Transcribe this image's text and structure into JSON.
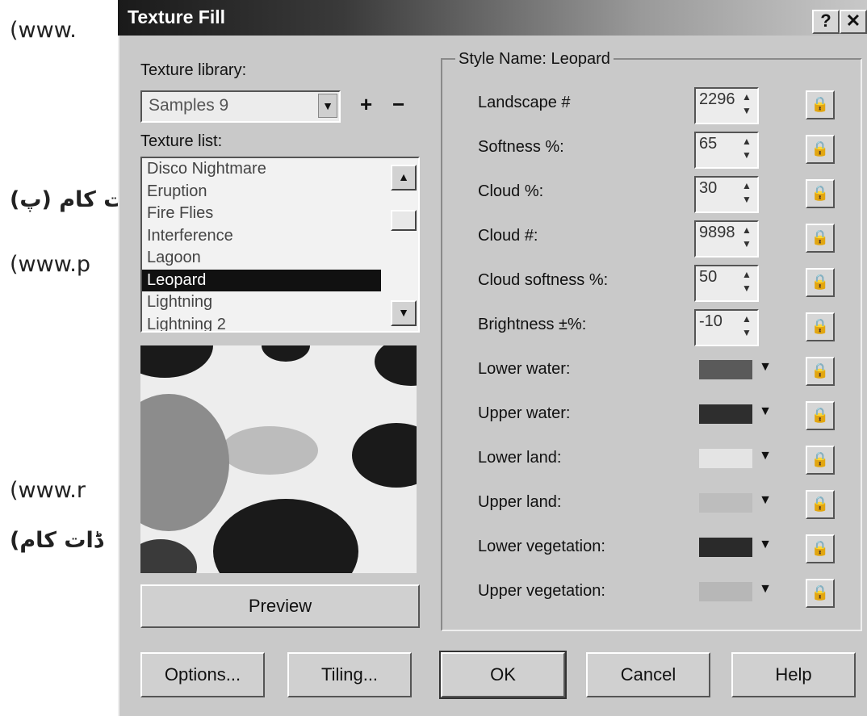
{
  "background_text": {
    "line1": "(www.",
    "line2": "(ڈات کام (پ",
    "line3": "(www.p",
    "line4": "(www.r",
    "line5": "(ڈات کام"
  },
  "dialog": {
    "title": "Texture Fill",
    "help_glyph": "?",
    "close_glyph": "✕"
  },
  "left_panel": {
    "library_label": "Texture library:",
    "library_value": "Samples 9",
    "add_glyph": "+",
    "remove_glyph": "−",
    "list_label": "Texture list:",
    "textures": [
      "Disco Nightmare",
      "Eruption",
      "Fire Flies",
      "Interference",
      "Lagoon",
      "Leopard",
      "Lightning",
      "Lightning 2"
    ],
    "selected_texture": "Leopard",
    "preview_button": "Preview"
  },
  "style_group": {
    "title": "Style Name: Leopard",
    "params": [
      {
        "label": "Landscape #",
        "value": "2296"
      },
      {
        "label": "Softness %:",
        "value": "65"
      },
      {
        "label": "Cloud %:",
        "value": "30"
      },
      {
        "label": "Cloud #:",
        "value": "9898"
      },
      {
        "label": "Cloud softness %:",
        "value": "50"
      },
      {
        "label": "Brightness ±%:",
        "value": "-10"
      }
    ],
    "colors": [
      {
        "label": "Lower water:",
        "color": "#5a5a5a"
      },
      {
        "label": "Upper water:",
        "color": "#2e2e2e"
      },
      {
        "label": "Lower land:",
        "color": "#e4e4e4"
      },
      {
        "label": "Upper land:",
        "color": "#bdbdbd"
      },
      {
        "label": "Lower vegetation:",
        "color": "#2a2a2a"
      },
      {
        "label": "Upper vegetation:",
        "color": "#b7b7b7"
      }
    ]
  },
  "footer": {
    "options": "Options...",
    "tiling": "Tiling...",
    "ok": "OK",
    "cancel": "Cancel",
    "help": "Help"
  },
  "icons": {
    "lock": "lock-icon",
    "spin": "spin-arrows-icon",
    "dropdown": "chevron-down-icon"
  }
}
